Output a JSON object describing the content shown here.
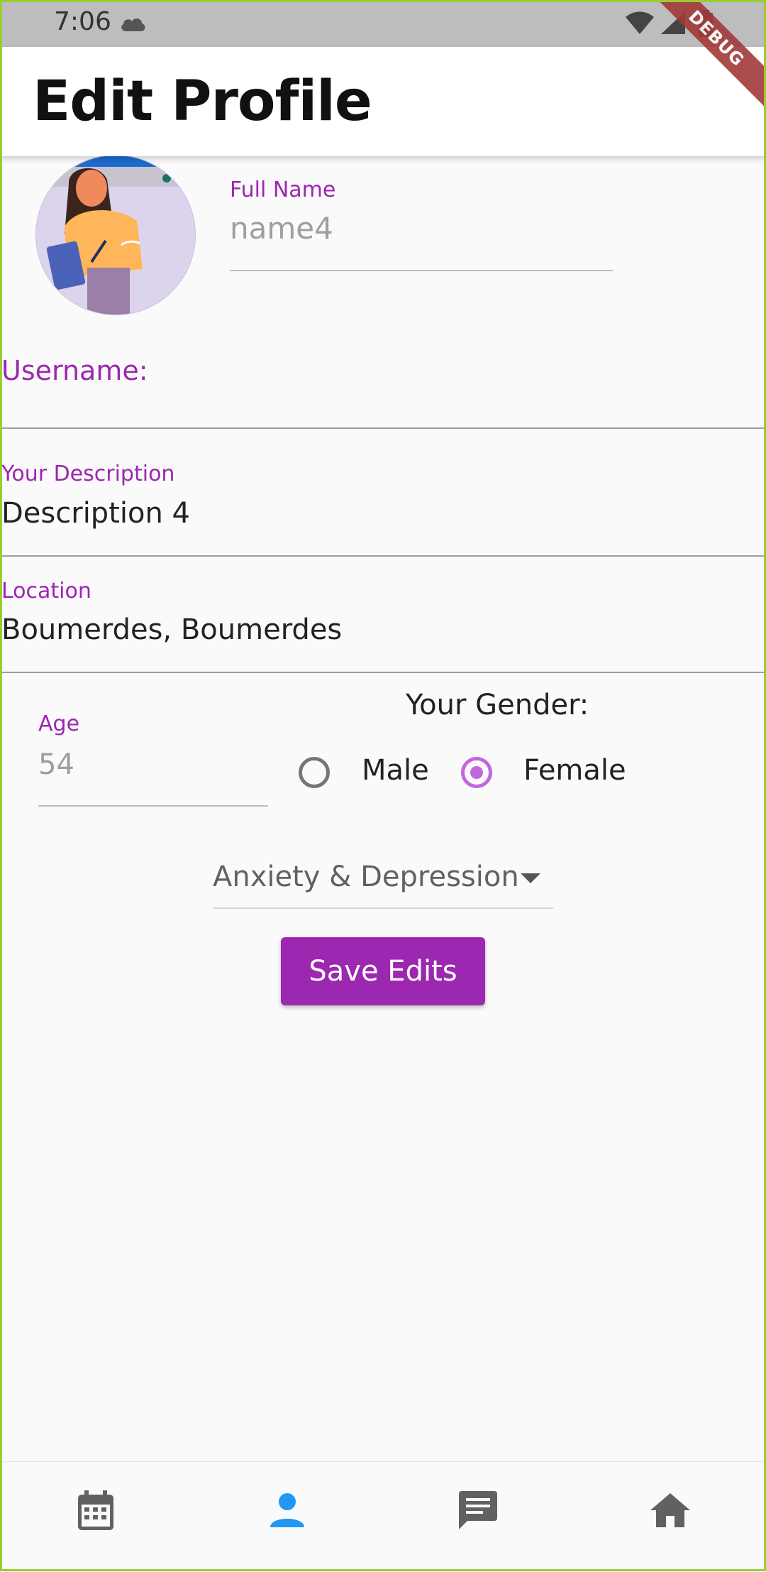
{
  "status_bar": {
    "time": "7:06"
  },
  "debug_banner": "DEBUG",
  "app_bar": {
    "title": "Edit Profile"
  },
  "full_name": {
    "label": "Full Name",
    "placeholder": "name4"
  },
  "username": {
    "label": "Username:"
  },
  "description": {
    "label": "Your Description",
    "value": "Description 4"
  },
  "location": {
    "label": "Location",
    "value": "Boumerdes, Boumerdes"
  },
  "age": {
    "label": "Age",
    "placeholder": "54"
  },
  "gender": {
    "title": "Your Gender:",
    "options": [
      {
        "label": "Male",
        "selected": false
      },
      {
        "label": "Female",
        "selected": true
      }
    ]
  },
  "condition_dropdown": {
    "value": "Anxiety & Depression"
  },
  "save_button": {
    "label": "Save Edits"
  },
  "bottom_nav": {
    "items": [
      {
        "icon": "calendar-icon",
        "active": false
      },
      {
        "icon": "person-icon",
        "active": true
      },
      {
        "icon": "chat-icon",
        "active": false
      },
      {
        "icon": "home-icon",
        "active": false
      }
    ]
  },
  "colors": {
    "accent": "#9c27b0",
    "radio_selected": "#c266e0",
    "nav_active": "#2196f3",
    "nav_inactive": "#616161"
  }
}
